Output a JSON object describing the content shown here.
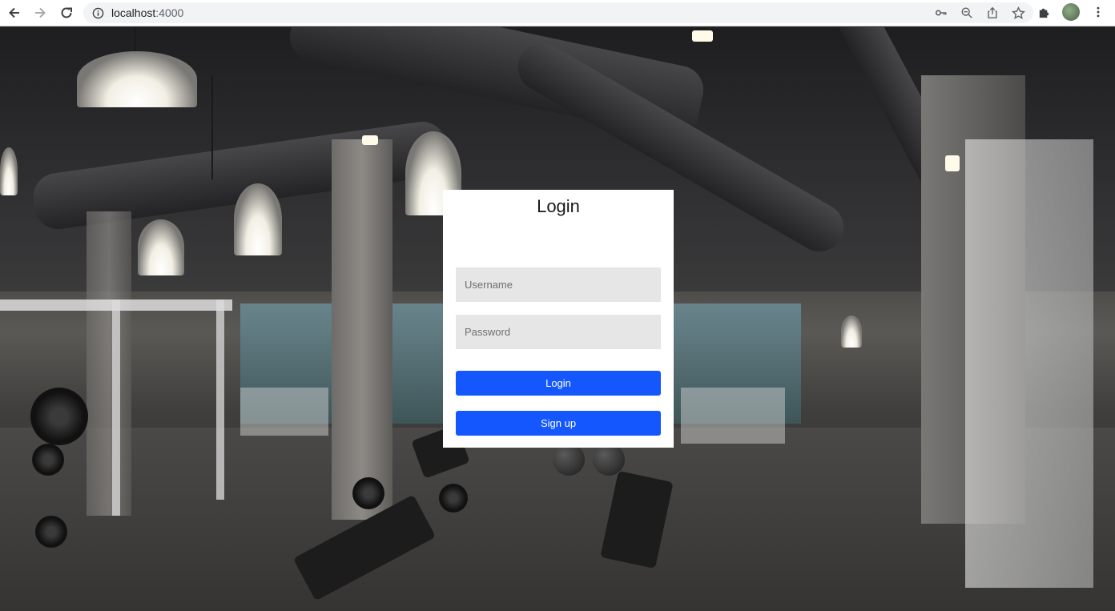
{
  "browser": {
    "url_host": "localhost",
    "url_port": ":4000",
    "icons": {
      "back": "arrow-left-icon",
      "forward": "arrow-right-icon",
      "reload": "reload-icon",
      "site_info": "info-icon",
      "password": "key-icon",
      "zoom": "zoom-out-icon",
      "share": "share-icon",
      "bookmark": "star-icon",
      "extensions": "puzzle-icon",
      "profile": "avatar",
      "menu": "kebab-menu-icon"
    }
  },
  "login": {
    "title": "Login",
    "username_placeholder": "Username",
    "password_placeholder": "Password",
    "login_label": "Login",
    "signup_label": "Sign up"
  },
  "colors": {
    "primary_button": "#1557ff",
    "input_background": "#e6e6e6",
    "card_background": "#ffffff"
  }
}
